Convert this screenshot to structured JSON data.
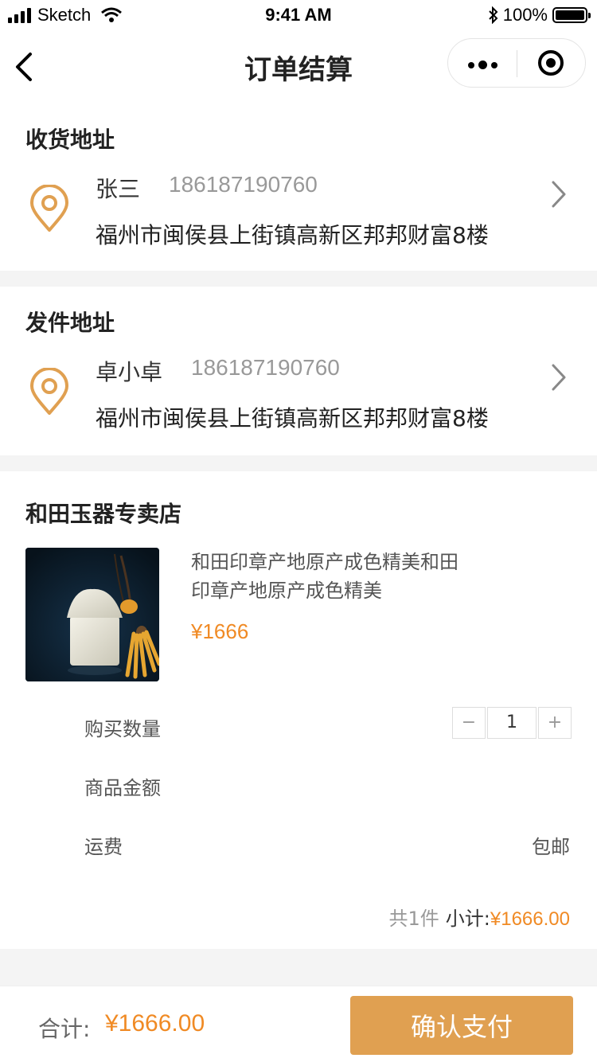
{
  "status_bar": {
    "carrier": "Sketch",
    "time": "9:41 AM",
    "battery": "100%"
  },
  "nav": {
    "title": "订单结算"
  },
  "receiver": {
    "section_title": "收货地址",
    "name": "张三",
    "phone": "186187190760",
    "address": "福州市闽侯县上街镇高新区邦邦财富8楼"
  },
  "sender": {
    "section_title": "发件地址",
    "name": "卓小卓",
    "phone": "186187190760",
    "address": "福州市闽侯县上街镇高新区邦邦财富8楼"
  },
  "order": {
    "store_name": "和田玉器专卖店",
    "product_title_line1": "和田印章产地原产成色精美和田",
    "product_title_line2": "印章产地原产成色精美",
    "product_price": "¥1666",
    "quantity_label": "购买数量",
    "quantity": "1",
    "minus": "−",
    "plus": "+",
    "amount_label": "商品金额",
    "amount_value": "",
    "shipping_label": "运费",
    "shipping_value": "包邮",
    "count_text": "共1件",
    "subtotal_label": "小计:",
    "subtotal_value": "¥1666.00"
  },
  "footer": {
    "total_label": "合计:",
    "total_value": "¥1666.00",
    "pay_button": "确认支付"
  },
  "colors": {
    "accent": "#f08a24",
    "button": "#e0a051",
    "pin": "#e0a051"
  }
}
